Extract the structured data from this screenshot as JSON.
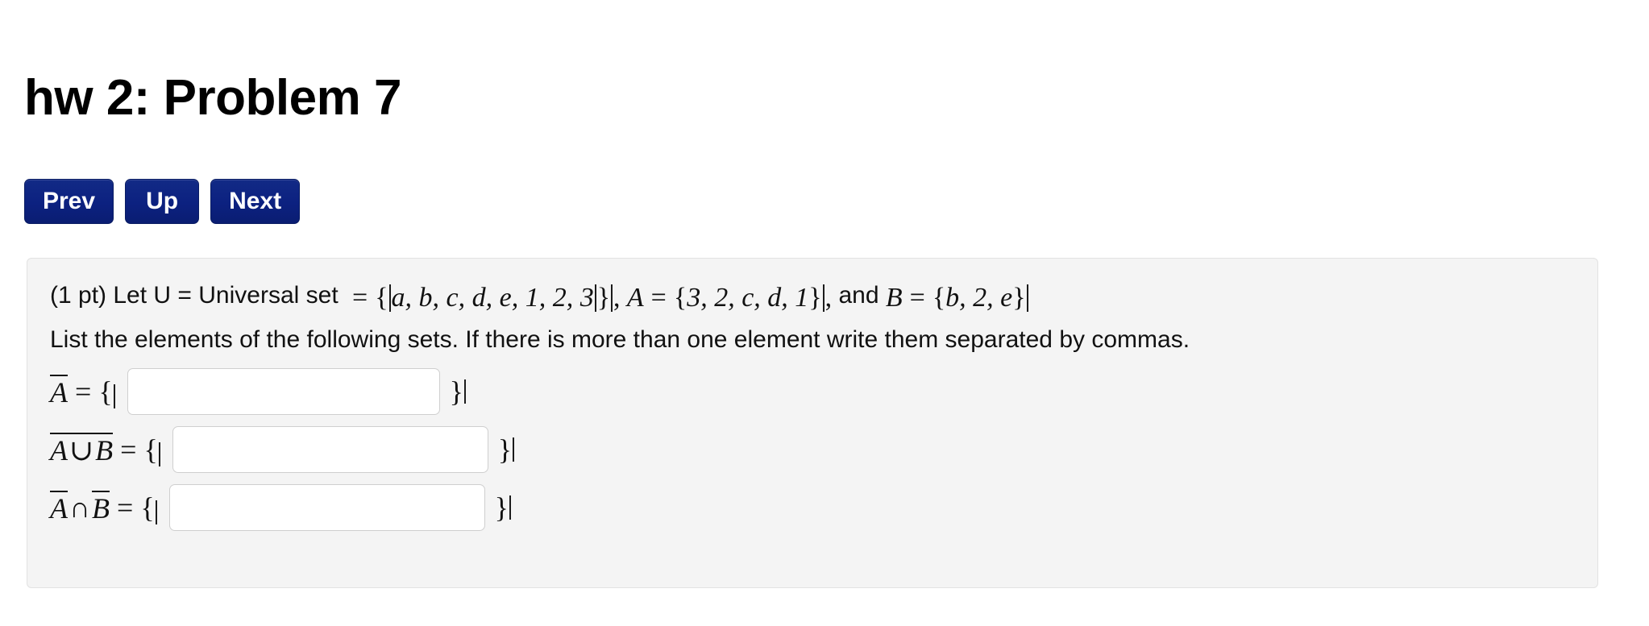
{
  "page": {
    "title": "hw 2: Problem 7"
  },
  "nav": {
    "buttons": [
      {
        "label": "Prev",
        "name": "prev-button"
      },
      {
        "label": "Up",
        "name": "up-button"
      },
      {
        "label": "Next",
        "name": "next-button"
      }
    ]
  },
  "problem": {
    "points": "(1 pt)",
    "statement_prefix": "Let U = Universal set",
    "universal_set": {
      "equals": "=",
      "open": "{",
      "elements": "a, b, c, d, e, 1, 2, 3",
      "close": "}"
    },
    "set_a": {
      "name": "A",
      "equals": "=",
      "open": "{",
      "elements": "3, 2, c, d, 1",
      "close": "}"
    },
    "conjunction": "and",
    "set_b": {
      "name": "B",
      "equals": "=",
      "open": "{",
      "elements": "b, 2, e",
      "close": "}"
    },
    "separator_comma": ",",
    "instructions": "List the elements of the following sets. If there is more than one element write them separated by commas."
  },
  "answers": [
    {
      "id": "answer-row-complement-a",
      "expression_plain": "Ā = {",
      "terms": [
        {
          "text": "A",
          "overline": true
        }
      ],
      "equals": "=",
      "open_brace": "{",
      "close_brace": "}",
      "value": "",
      "placeholder": ""
    },
    {
      "id": "answer-row-complement-a-union-b",
      "expression_plain": "A ∪ B (overline) = {",
      "terms": [
        {
          "text": "A",
          "overline": false
        },
        {
          "text": "∪",
          "overline": false
        },
        {
          "text": "B",
          "overline": false
        }
      ],
      "group_overline": true,
      "equals": "=",
      "open_brace": "{",
      "close_brace": "}",
      "value": "",
      "placeholder": ""
    },
    {
      "id": "answer-row-complement-a-intersect-complement-b",
      "expression_plain": "Ā ∩ B̄ = {",
      "terms": [
        {
          "text": "A",
          "overline": true
        },
        {
          "text": "∩",
          "overline": false
        },
        {
          "text": "B",
          "overline": true
        }
      ],
      "equals": "=",
      "open_brace": "{",
      "close_brace": "}",
      "value": "",
      "placeholder": ""
    }
  ],
  "symbols": {
    "union": "∪",
    "intersection": "∩",
    "equals": "=",
    "open_brace": "{",
    "close_brace": "}"
  },
  "colors": {
    "button_navy": "#0c2180",
    "panel_background": "#f4f4f4",
    "panel_border": "#e2e2e2",
    "input_border": "#cfcfcf",
    "text": "#111111",
    "page_background": "#ffffff"
  }
}
